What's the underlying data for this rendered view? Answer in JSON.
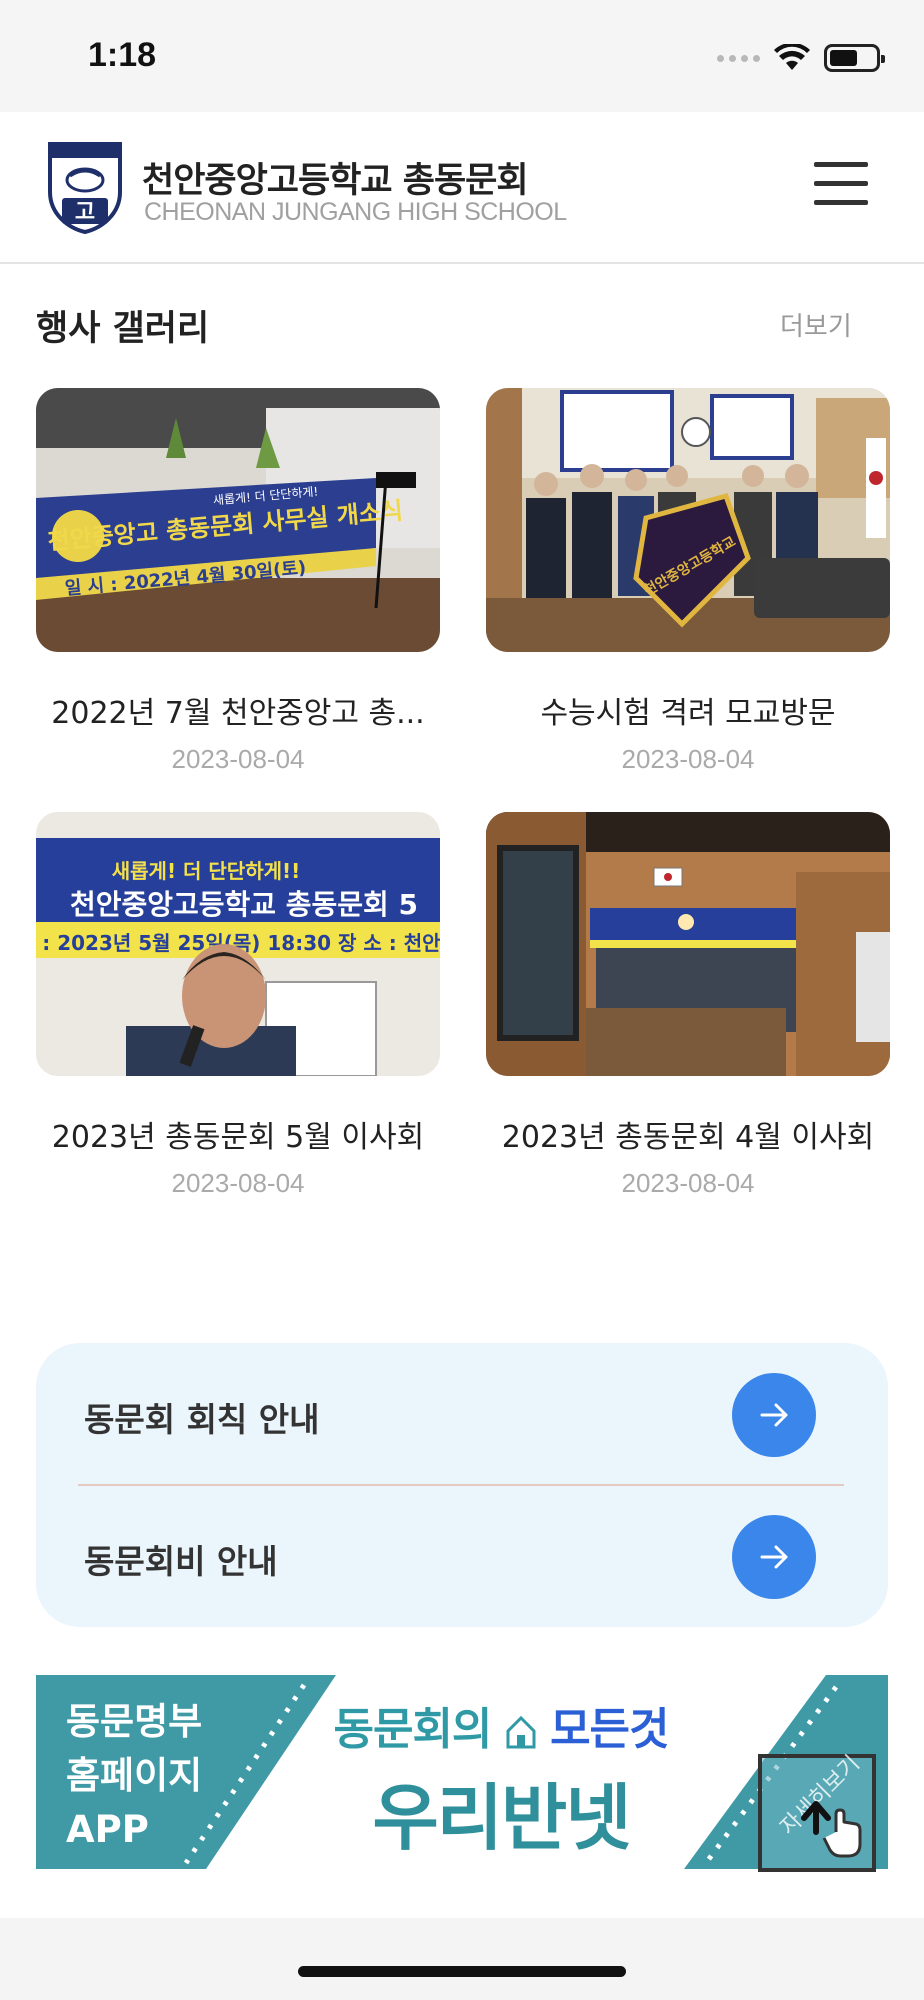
{
  "status_bar": {
    "time": "1:18"
  },
  "header": {
    "school_name": "천안중앙고등학교 총동문회",
    "school_name_en": "CHEONAN JUNGANG HIGH SCHOOL",
    "logo_char": "고"
  },
  "gallery": {
    "title": "행사 갤러리",
    "more_label": "더보기",
    "items": [
      {
        "title": "2022년 7월 천안중앙고 총...",
        "date": "2023-08-04",
        "sign_text": "천안중앙고 총동문회 사무실 개소식",
        "sign_sub": "일 시 : 2022년 4월 30일(토)",
        "slogan": "새롭게! 더 단단하게!"
      },
      {
        "title": "수능시험 격려 모교방문",
        "date": "2023-08-04",
        "flag_text": "천안중앙고등학교"
      },
      {
        "title": "2023년 총동문회 5월 이사회",
        "date": "2023-08-04",
        "sign_text": "천안중앙고등학교 총동문회 5",
        "sign_sub": "일 시 : 2023년 5월 25일(목) 18:30   장 소 : 천안",
        "slogan": "새롭게! 더 단단하게!!"
      },
      {
        "title": "2023년 총동문회 4월 이사회",
        "date": "2023-08-04"
      }
    ]
  },
  "info_links": [
    {
      "label": "동문회 회칙 안내"
    },
    {
      "label": "동문회비 안내"
    }
  ],
  "banner": {
    "left_lines": [
      "동문명부",
      "홈페이지",
      "APP"
    ],
    "headline_a": "동문회의",
    "headline_b": "모든것",
    "brand": "우리반넷"
  },
  "scroll_top": {
    "label": "자세히보기"
  },
  "colors": {
    "accent_blue": "#3a86ea",
    "teal": "#2f8f9b",
    "info_bg": "#eaf5fc"
  }
}
